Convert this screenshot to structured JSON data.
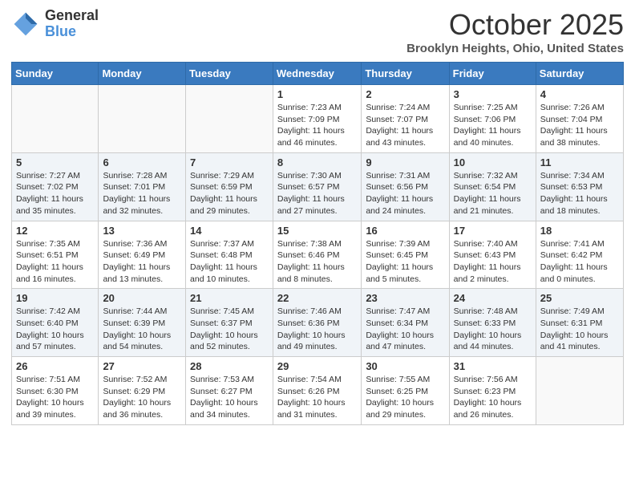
{
  "header": {
    "logo_general": "General",
    "logo_blue": "Blue",
    "month_title": "October 2025",
    "location": "Brooklyn Heights, Ohio, United States"
  },
  "days_of_week": [
    "Sunday",
    "Monday",
    "Tuesday",
    "Wednesday",
    "Thursday",
    "Friday",
    "Saturday"
  ],
  "weeks": [
    [
      {
        "day": "",
        "info": ""
      },
      {
        "day": "",
        "info": ""
      },
      {
        "day": "",
        "info": ""
      },
      {
        "day": "1",
        "info": "Sunrise: 7:23 AM\nSunset: 7:09 PM\nDaylight: 11 hours and 46 minutes."
      },
      {
        "day": "2",
        "info": "Sunrise: 7:24 AM\nSunset: 7:07 PM\nDaylight: 11 hours and 43 minutes."
      },
      {
        "day": "3",
        "info": "Sunrise: 7:25 AM\nSunset: 7:06 PM\nDaylight: 11 hours and 40 minutes."
      },
      {
        "day": "4",
        "info": "Sunrise: 7:26 AM\nSunset: 7:04 PM\nDaylight: 11 hours and 38 minutes."
      }
    ],
    [
      {
        "day": "5",
        "info": "Sunrise: 7:27 AM\nSunset: 7:02 PM\nDaylight: 11 hours and 35 minutes."
      },
      {
        "day": "6",
        "info": "Sunrise: 7:28 AM\nSunset: 7:01 PM\nDaylight: 11 hours and 32 minutes."
      },
      {
        "day": "7",
        "info": "Sunrise: 7:29 AM\nSunset: 6:59 PM\nDaylight: 11 hours and 29 minutes."
      },
      {
        "day": "8",
        "info": "Sunrise: 7:30 AM\nSunset: 6:57 PM\nDaylight: 11 hours and 27 minutes."
      },
      {
        "day": "9",
        "info": "Sunrise: 7:31 AM\nSunset: 6:56 PM\nDaylight: 11 hours and 24 minutes."
      },
      {
        "day": "10",
        "info": "Sunrise: 7:32 AM\nSunset: 6:54 PM\nDaylight: 11 hours and 21 minutes."
      },
      {
        "day": "11",
        "info": "Sunrise: 7:34 AM\nSunset: 6:53 PM\nDaylight: 11 hours and 18 minutes."
      }
    ],
    [
      {
        "day": "12",
        "info": "Sunrise: 7:35 AM\nSunset: 6:51 PM\nDaylight: 11 hours and 16 minutes."
      },
      {
        "day": "13",
        "info": "Sunrise: 7:36 AM\nSunset: 6:49 PM\nDaylight: 11 hours and 13 minutes."
      },
      {
        "day": "14",
        "info": "Sunrise: 7:37 AM\nSunset: 6:48 PM\nDaylight: 11 hours and 10 minutes."
      },
      {
        "day": "15",
        "info": "Sunrise: 7:38 AM\nSunset: 6:46 PM\nDaylight: 11 hours and 8 minutes."
      },
      {
        "day": "16",
        "info": "Sunrise: 7:39 AM\nSunset: 6:45 PM\nDaylight: 11 hours and 5 minutes."
      },
      {
        "day": "17",
        "info": "Sunrise: 7:40 AM\nSunset: 6:43 PM\nDaylight: 11 hours and 2 minutes."
      },
      {
        "day": "18",
        "info": "Sunrise: 7:41 AM\nSunset: 6:42 PM\nDaylight: 11 hours and 0 minutes."
      }
    ],
    [
      {
        "day": "19",
        "info": "Sunrise: 7:42 AM\nSunset: 6:40 PM\nDaylight: 10 hours and 57 minutes."
      },
      {
        "day": "20",
        "info": "Sunrise: 7:44 AM\nSunset: 6:39 PM\nDaylight: 10 hours and 54 minutes."
      },
      {
        "day": "21",
        "info": "Sunrise: 7:45 AM\nSunset: 6:37 PM\nDaylight: 10 hours and 52 minutes."
      },
      {
        "day": "22",
        "info": "Sunrise: 7:46 AM\nSunset: 6:36 PM\nDaylight: 10 hours and 49 minutes."
      },
      {
        "day": "23",
        "info": "Sunrise: 7:47 AM\nSunset: 6:34 PM\nDaylight: 10 hours and 47 minutes."
      },
      {
        "day": "24",
        "info": "Sunrise: 7:48 AM\nSunset: 6:33 PM\nDaylight: 10 hours and 44 minutes."
      },
      {
        "day": "25",
        "info": "Sunrise: 7:49 AM\nSunset: 6:31 PM\nDaylight: 10 hours and 41 minutes."
      }
    ],
    [
      {
        "day": "26",
        "info": "Sunrise: 7:51 AM\nSunset: 6:30 PM\nDaylight: 10 hours and 39 minutes."
      },
      {
        "day": "27",
        "info": "Sunrise: 7:52 AM\nSunset: 6:29 PM\nDaylight: 10 hours and 36 minutes."
      },
      {
        "day": "28",
        "info": "Sunrise: 7:53 AM\nSunset: 6:27 PM\nDaylight: 10 hours and 34 minutes."
      },
      {
        "day": "29",
        "info": "Sunrise: 7:54 AM\nSunset: 6:26 PM\nDaylight: 10 hours and 31 minutes."
      },
      {
        "day": "30",
        "info": "Sunrise: 7:55 AM\nSunset: 6:25 PM\nDaylight: 10 hours and 29 minutes."
      },
      {
        "day": "31",
        "info": "Sunrise: 7:56 AM\nSunset: 6:23 PM\nDaylight: 10 hours and 26 minutes."
      },
      {
        "day": "",
        "info": ""
      }
    ]
  ]
}
